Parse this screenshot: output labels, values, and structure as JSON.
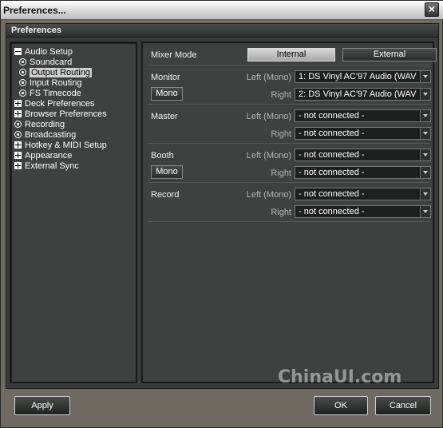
{
  "window": {
    "title": "Preferences..."
  },
  "header": {
    "title": "Preferences"
  },
  "tree": {
    "items": [
      {
        "label": "Audio Setup",
        "icon": "minus-icon"
      },
      {
        "label": "Soundcard",
        "icon": "radio-icon"
      },
      {
        "label": "Output Routing",
        "icon": "radio-icon"
      },
      {
        "label": "Input Routing",
        "icon": "radio-icon"
      },
      {
        "label": "FS Timecode",
        "icon": "radio-icon"
      },
      {
        "label": "Deck Preferences",
        "icon": "plus-icon"
      },
      {
        "label": "Browser Preferences",
        "icon": "plus-icon"
      },
      {
        "label": "Recording",
        "icon": "radio-icon"
      },
      {
        "label": "Broadcasting",
        "icon": "radio-icon"
      },
      {
        "label": "Hotkey & MIDI Setup",
        "icon": "plus-icon"
      },
      {
        "label": "Appearance",
        "icon": "plus-icon"
      },
      {
        "label": "External Sync",
        "icon": "plus-icon"
      }
    ]
  },
  "mixer": {
    "label": "Mixer Mode",
    "internal": "Internal",
    "external": "External",
    "selected": "Internal"
  },
  "monitor": {
    "label": "Monitor",
    "mono": "Mono",
    "left_label": "Left (Mono)",
    "right_label": "Right",
    "left_value": "1: DS Vinyl AC'97 Audio (WAV",
    "right_value": "2: DS Vinyl AC'97 Audio (WAV"
  },
  "master": {
    "label": "Master",
    "left_label": "Left (Mono)",
    "right_label": "Right",
    "left_value": "- not connected -",
    "right_value": "- not connected -"
  },
  "booth": {
    "label": "Booth",
    "mono": "Mono",
    "left_label": "Left (Mono)",
    "right_label": "Right",
    "left_value": "- not connected -",
    "right_value": "- not connected -"
  },
  "record": {
    "label": "Record",
    "left_label": "Left (Mono)",
    "right_label": "Right",
    "left_value": "- not connected -",
    "right_value": "- not connected -"
  },
  "watermark": "ChinaUI.com",
  "buttons": {
    "apply": "Apply",
    "ok": "OK",
    "cancel": "Cancel"
  }
}
